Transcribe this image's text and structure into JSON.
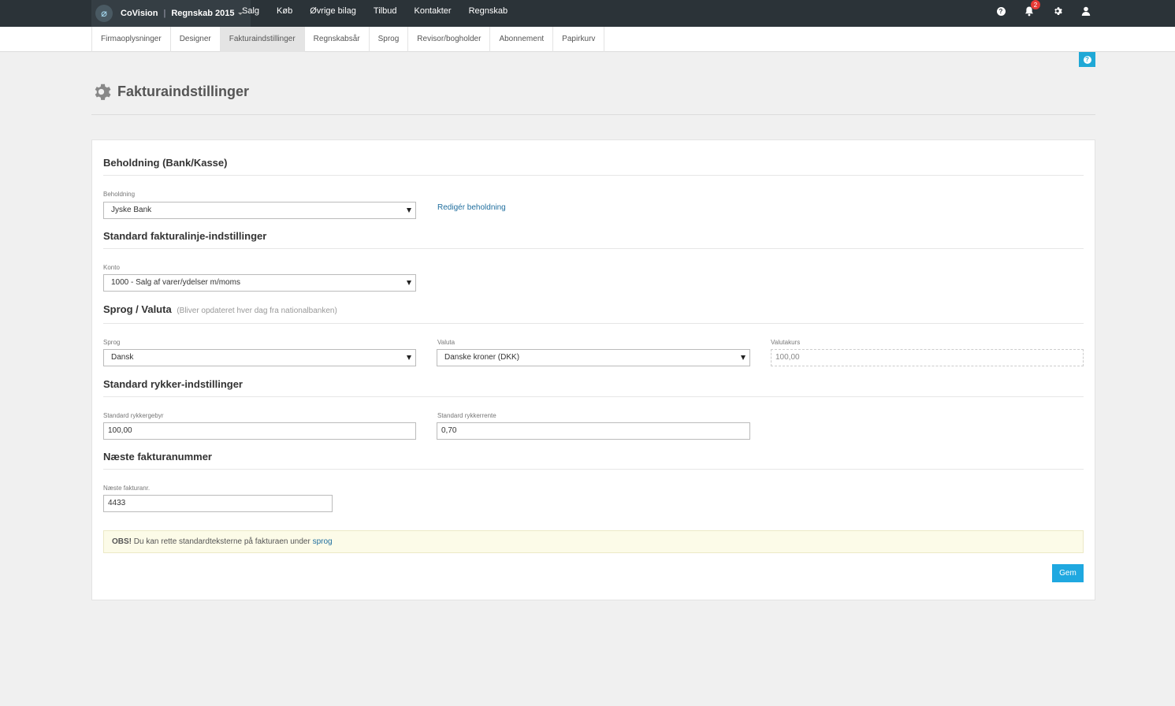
{
  "topbar": {
    "brand_name": "CoVision",
    "brand_separator": "|",
    "brand_year": "Regnskab 2015",
    "nav": [
      "Salg",
      "Køb",
      "Øvrige bilag",
      "Tilbud",
      "Kontakter",
      "Regnskab"
    ],
    "notification_count": "2",
    "icons": [
      "help-icon",
      "bell-icon",
      "gear-icon",
      "user-icon"
    ]
  },
  "subnav": {
    "items": [
      "Firmaoplysninger",
      "Designer",
      "Fakturaindstillinger",
      "Regnskabsår",
      "Sprog",
      "Revisor/bogholder",
      "Abonnement",
      "Papirkurv"
    ],
    "active_index": 2
  },
  "page": {
    "title": "Fakturaindstillinger"
  },
  "form": {
    "beholdning": {
      "title": "Beholdning (Bank/Kasse)",
      "label": "Beholdning",
      "value": "Jyske Bank",
      "edit_link": "Redigér beholdning"
    },
    "fakturalinje": {
      "title": "Standard fakturalinje-indstillinger",
      "label": "Konto",
      "value": "1000 - Salg af varer/ydelser m/moms"
    },
    "sprog_valuta": {
      "title": "Sprog / Valuta",
      "subtitle": "(Bliver opdateret hver dag fra nationalbanken)",
      "sprog_label": "Sprog",
      "sprog_value": "Dansk",
      "valuta_label": "Valuta",
      "valuta_value": "Danske kroner (DKK)",
      "valutakurs_label": "Valutakurs",
      "valutakurs_value": "100,00"
    },
    "rykker": {
      "title": "Standard rykker-indstillinger",
      "gebyr_label": "Standard rykkergebyr",
      "gebyr_value": "100,00",
      "rente_label": "Standard rykkerrente",
      "rente_value": "0,70"
    },
    "fakturanummer": {
      "title": "Næste fakturanummer",
      "label": "Næste fakturanr.",
      "value": "4433"
    },
    "notice": {
      "bold": "OBS!",
      "text": "Du kan rette standardteksterne på fakturaen under",
      "link": "sprog"
    },
    "save_label": "Gem"
  },
  "colors": {
    "topbar": "#2b3338",
    "accent": "#1fa8e0",
    "link": "#1f6e9e",
    "notice_bg": "#fcfbe8"
  }
}
